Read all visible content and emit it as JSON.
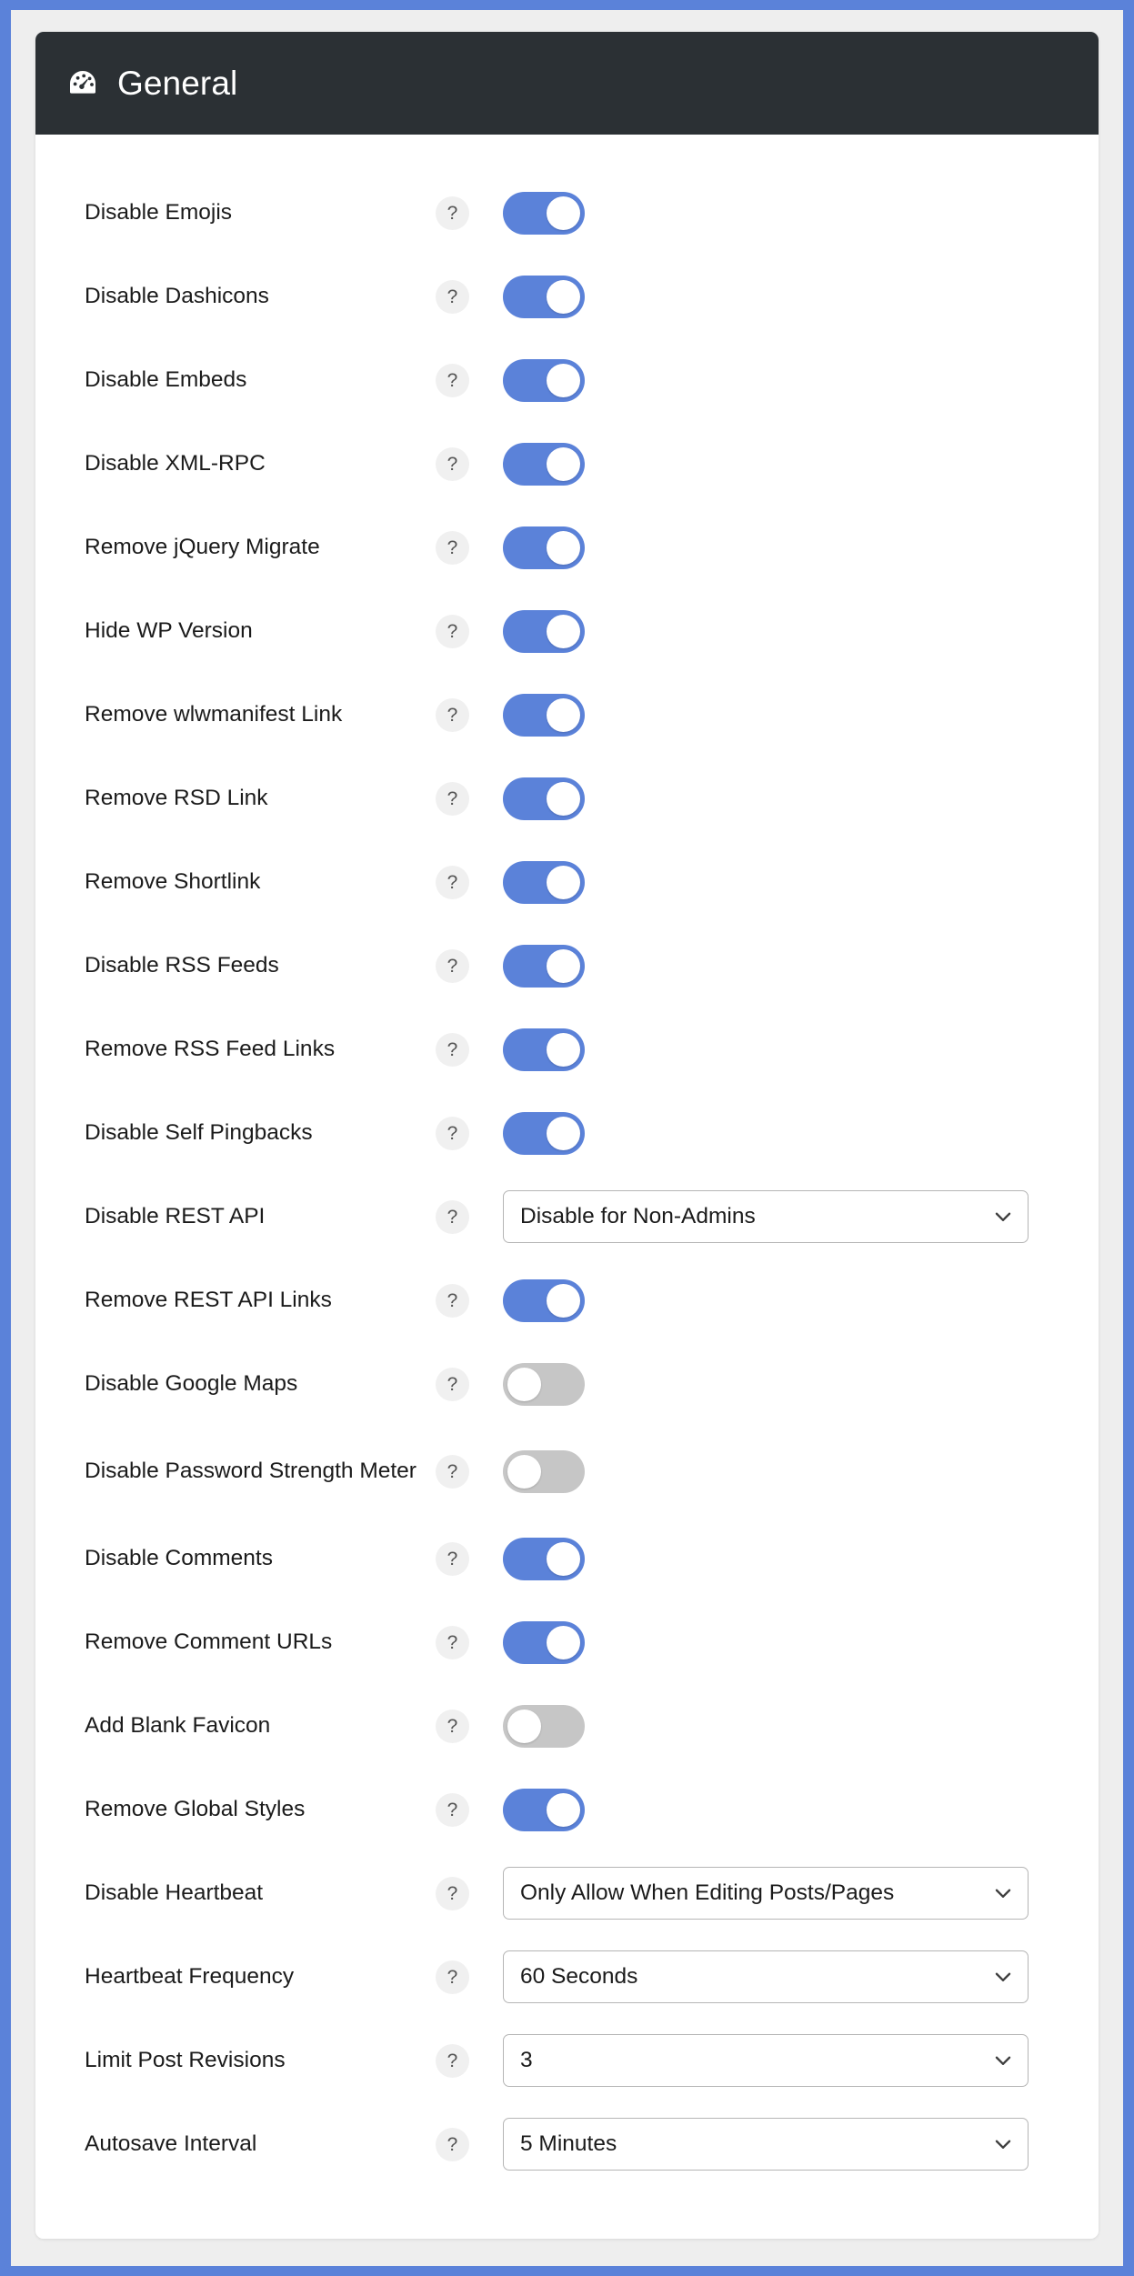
{
  "header": {
    "title": "General",
    "icon": "speedometer-icon",
    "background_color": "#2b3034",
    "text_color": "#ffffff"
  },
  "theme": {
    "frame_color": "#5b82d9",
    "page_background": "#eeeeee",
    "card_background": "#ffffff",
    "toggle_on_color": "#5b82d9",
    "toggle_off_color": "#c6c6c6",
    "label_color": "#1b1b1b",
    "help_badge_background": "#f0f0f0",
    "select_border_color": "#b5b5b5"
  },
  "help_badge_label": "?",
  "settings": [
    {
      "label": "Disable Emojis",
      "control": "toggle",
      "value": "on"
    },
    {
      "label": "Disable Dashicons",
      "control": "toggle",
      "value": "on"
    },
    {
      "label": "Disable Embeds",
      "control": "toggle",
      "value": "on"
    },
    {
      "label": "Disable XML-RPC",
      "control": "toggle",
      "value": "on"
    },
    {
      "label": "Remove jQuery Migrate",
      "control": "toggle",
      "value": "on"
    },
    {
      "label": "Hide WP Version",
      "control": "toggle",
      "value": "on"
    },
    {
      "label": "Remove wlwmanifest Link",
      "control": "toggle",
      "value": "on"
    },
    {
      "label": "Remove RSD Link",
      "control": "toggle",
      "value": "on"
    },
    {
      "label": "Remove Shortlink",
      "control": "toggle",
      "value": "on"
    },
    {
      "label": "Disable RSS Feeds",
      "control": "toggle",
      "value": "on"
    },
    {
      "label": "Remove RSS Feed Links",
      "control": "toggle",
      "value": "on"
    },
    {
      "label": "Disable Self Pingbacks",
      "control": "toggle",
      "value": "on"
    },
    {
      "label": "Disable REST API",
      "control": "select",
      "value": "Disable for Non-Admins"
    },
    {
      "label": "Remove REST API Links",
      "control": "toggle",
      "value": "on"
    },
    {
      "label": "Disable Google Maps",
      "control": "toggle",
      "value": "off"
    },
    {
      "label": "Disable Password Strength Meter",
      "control": "toggle",
      "value": "off",
      "two_line": true
    },
    {
      "label": "Disable Comments",
      "control": "toggle",
      "value": "on"
    },
    {
      "label": "Remove Comment URLs",
      "control": "toggle",
      "value": "on"
    },
    {
      "label": "Add Blank Favicon",
      "control": "toggle",
      "value": "off"
    },
    {
      "label": "Remove Global Styles",
      "control": "toggle",
      "value": "on"
    },
    {
      "label": "Disable Heartbeat",
      "control": "select",
      "value": "Only Allow When Editing Posts/Pages"
    },
    {
      "label": "Heartbeat Frequency",
      "control": "select",
      "value": "60 Seconds"
    },
    {
      "label": "Limit Post Revisions",
      "control": "select",
      "value": "3"
    },
    {
      "label": "Autosave Interval",
      "control": "select",
      "value": "5 Minutes"
    }
  ]
}
